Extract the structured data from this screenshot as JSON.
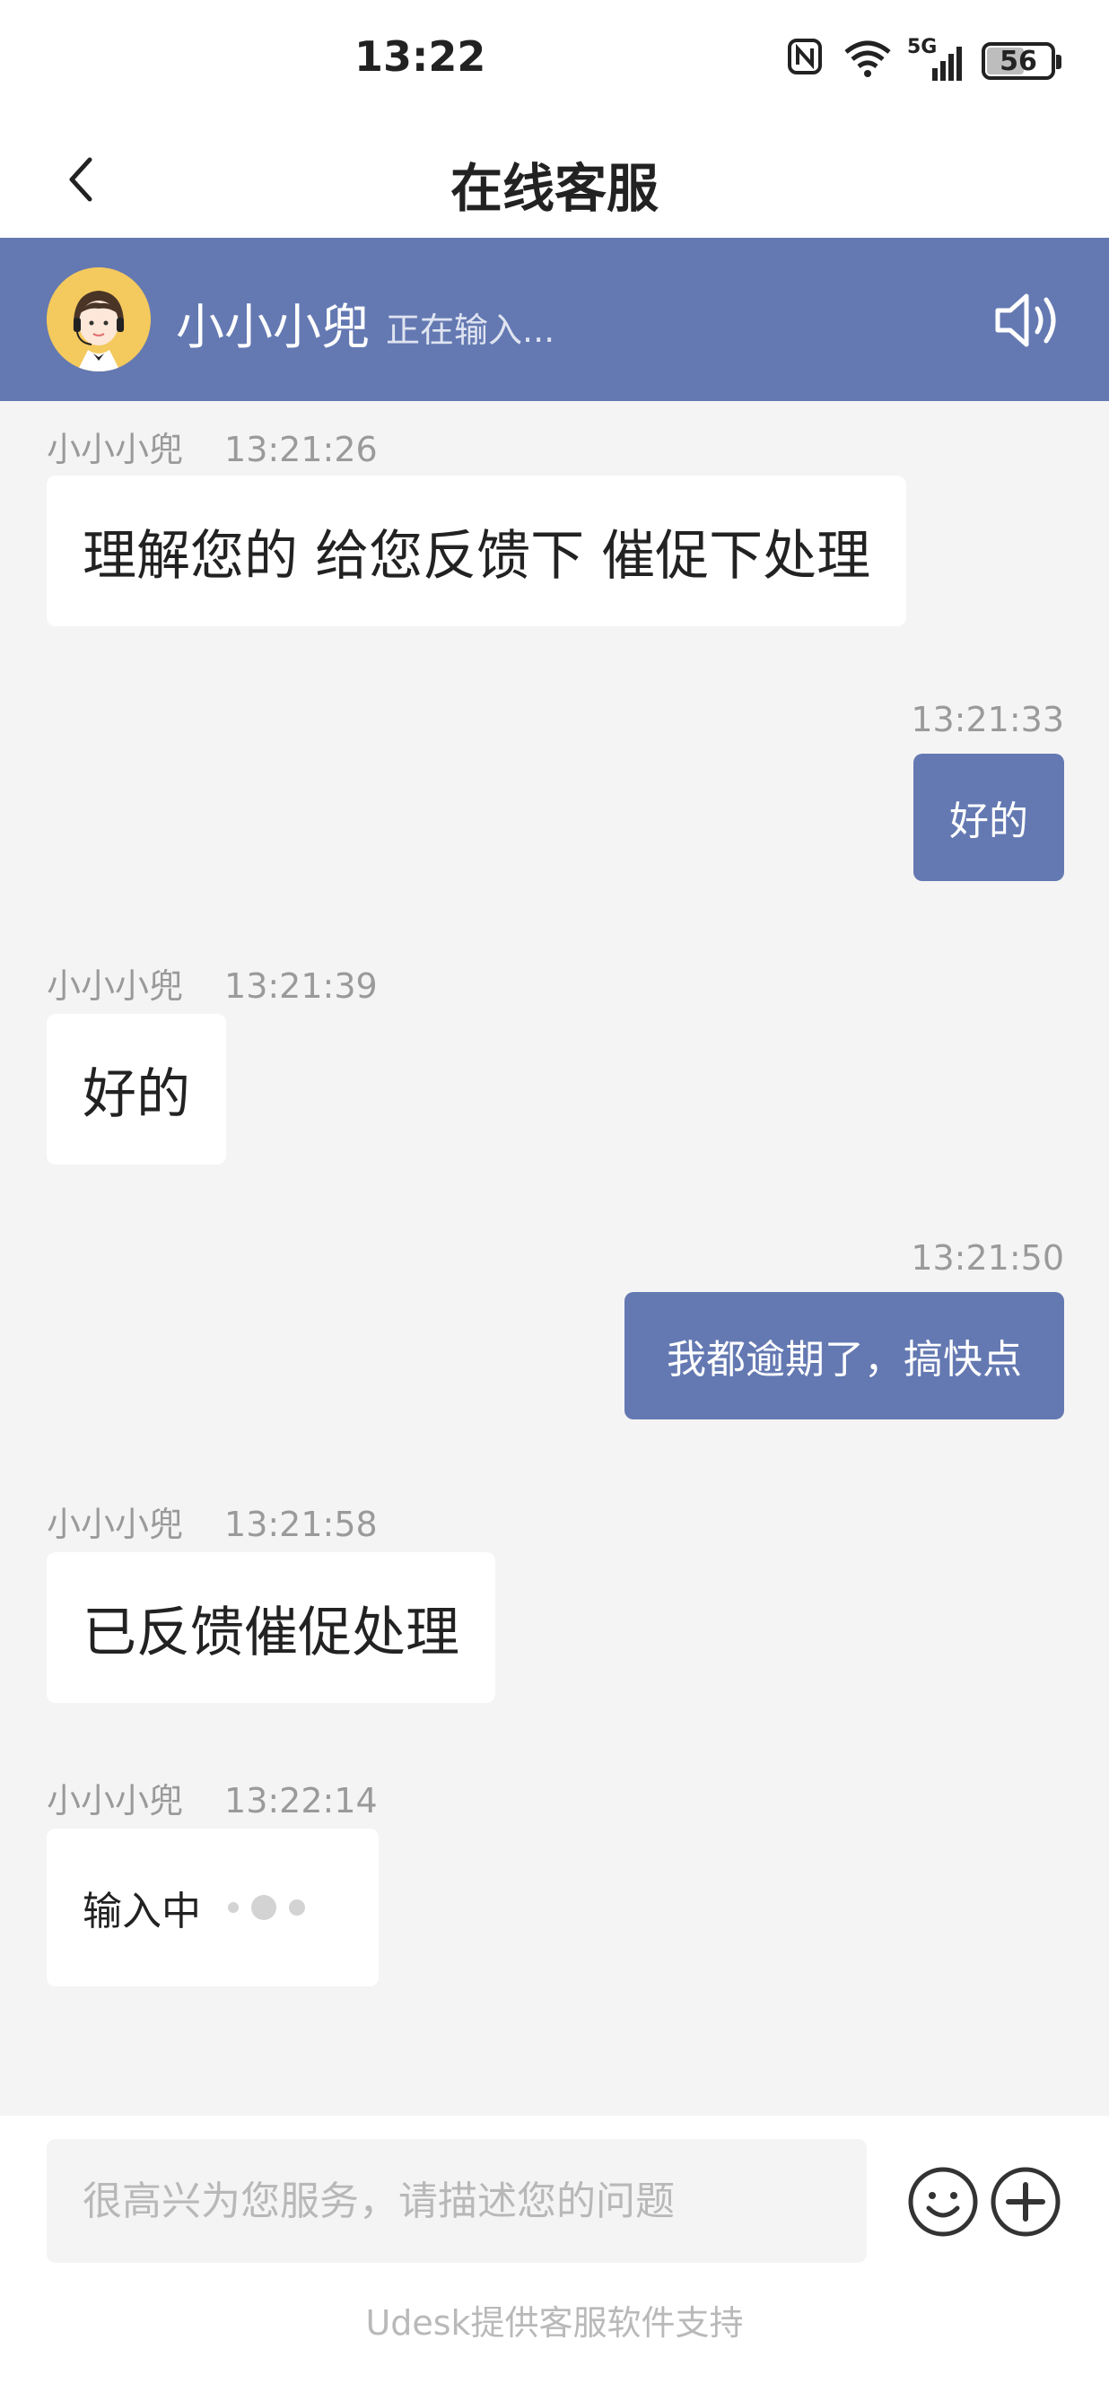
{
  "status_bar": {
    "time": "13:22",
    "network": "5G",
    "battery": "56",
    "battery_level": 0.56
  },
  "header": {
    "title": "在线客服"
  },
  "agent": {
    "name": "小小小兜",
    "status": "正在输入..."
  },
  "messages": [
    {
      "side": "left",
      "sender": "小小小兜",
      "time": "13:21:26",
      "text": "理解您的 给您反馈下 催促下处理"
    },
    {
      "side": "right",
      "time": "13:21:33",
      "text": "好的"
    },
    {
      "side": "left",
      "sender": "小小小兜",
      "time": "13:21:39",
      "text": "好的"
    },
    {
      "side": "right",
      "time": "13:21:50",
      "text": "我都逾期了，搞快点"
    },
    {
      "side": "left",
      "sender": "小小小兜",
      "time": "13:21:58",
      "text": "已反馈催促处理"
    },
    {
      "side": "left",
      "sender": "小小小兜",
      "time": "13:22:14",
      "text": "输入中"
    }
  ],
  "composer": {
    "placeholder": "很高兴为您服务，请描述您的问题",
    "value": "",
    "footer": "Udesk提供客服软件支持"
  },
  "colors": {
    "accent": "#6479b2",
    "background": "#f4f4f4"
  },
  "icons": {
    "back": "chevron-left-icon",
    "speaker": "speaker-icon",
    "emoji": "smiley-icon",
    "plus": "plus-circle-icon"
  }
}
